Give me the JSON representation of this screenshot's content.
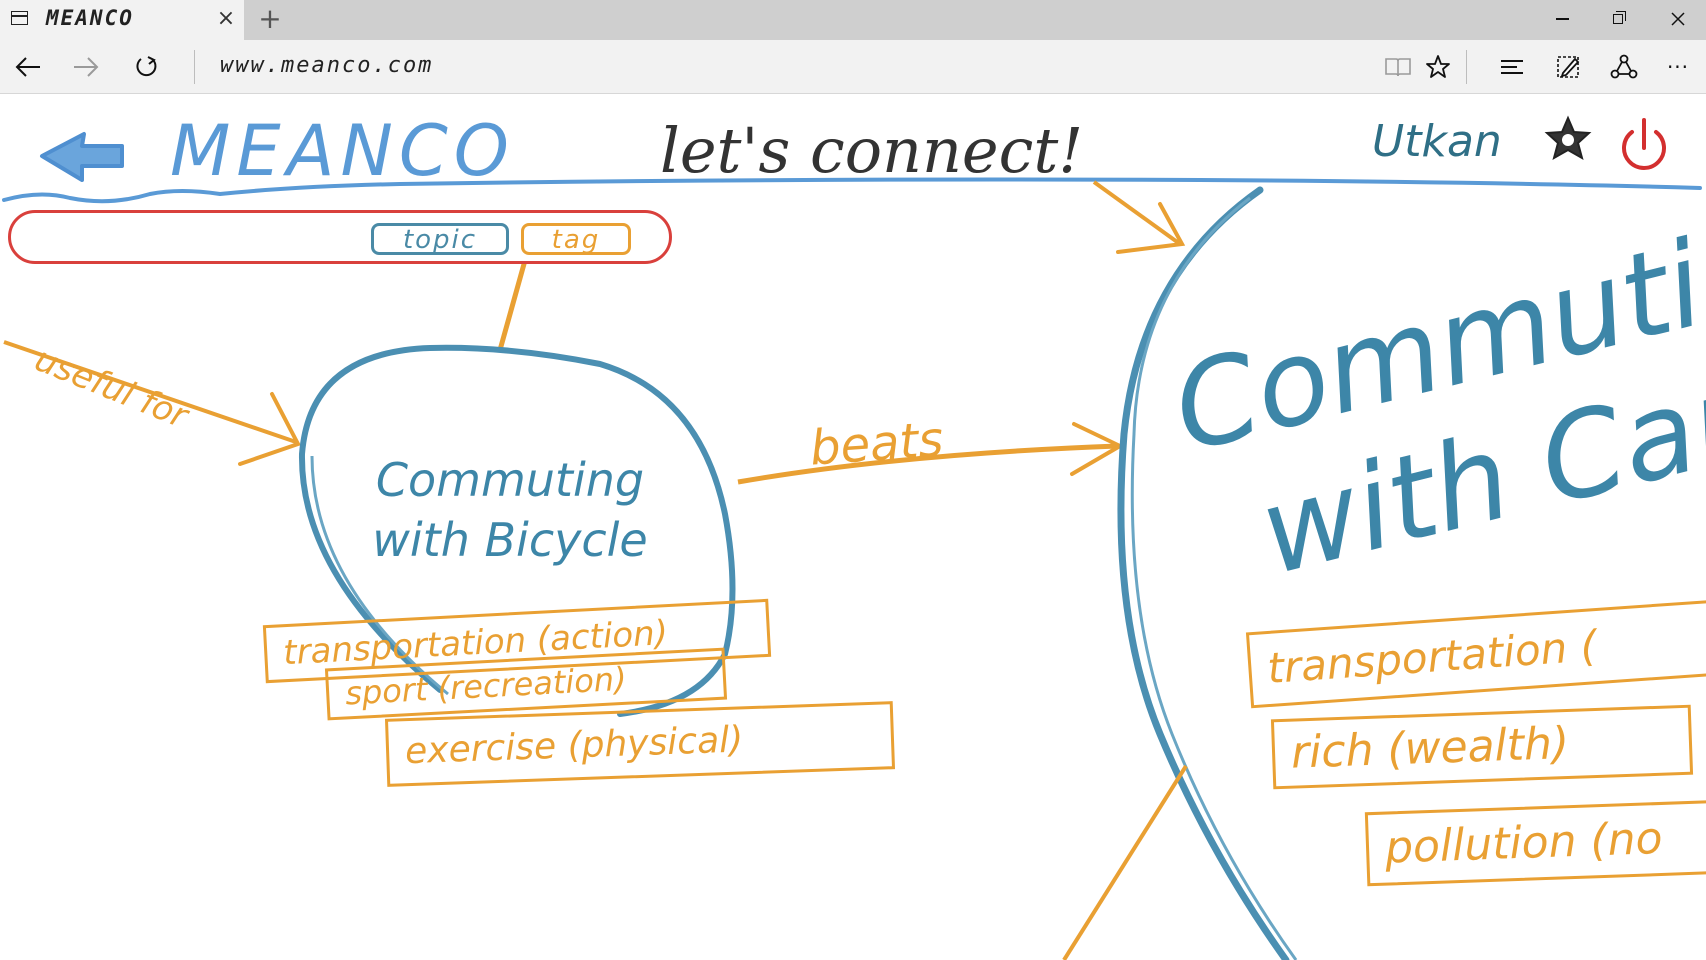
{
  "browser": {
    "tab": {
      "title": "MEANCO",
      "close_glyph": "×"
    },
    "new_tab_glyph": "+",
    "address": {
      "url": "www.meanco.com"
    },
    "window_controls": [
      "minimize",
      "restore",
      "close"
    ],
    "toolbar_icons": [
      "reading-view",
      "favorite",
      "hub",
      "web-note",
      "share",
      "more"
    ],
    "more_glyph": "···"
  },
  "header": {
    "logo": "MEANCO",
    "slogan": "let's connect!",
    "username": "Utkan"
  },
  "search": {
    "value": "",
    "topic_label": "topic",
    "tag_label": "tag"
  },
  "relations": {
    "useful_for": "useful for",
    "beats": "beats"
  },
  "nodes": {
    "bicycle": {
      "title": "Commuting with Bicycle",
      "tags": [
        "transportation (action)",
        "sport (recreation)",
        "exercise (physical)"
      ]
    },
    "car": {
      "title": "Commuting with Car",
      "tags": [
        "transportation (",
        "rich (wealth)",
        "pollution (no"
      ]
    }
  },
  "colors": {
    "tab_bar": "#cfcfcf",
    "toolbar": "#f2f2f2",
    "brand_blue": "#5a9ad6",
    "node_blue": "#3d86a8",
    "tag_orange": "#e9a033",
    "search_red": "#d9403c",
    "power_red": "#d32f2f"
  }
}
